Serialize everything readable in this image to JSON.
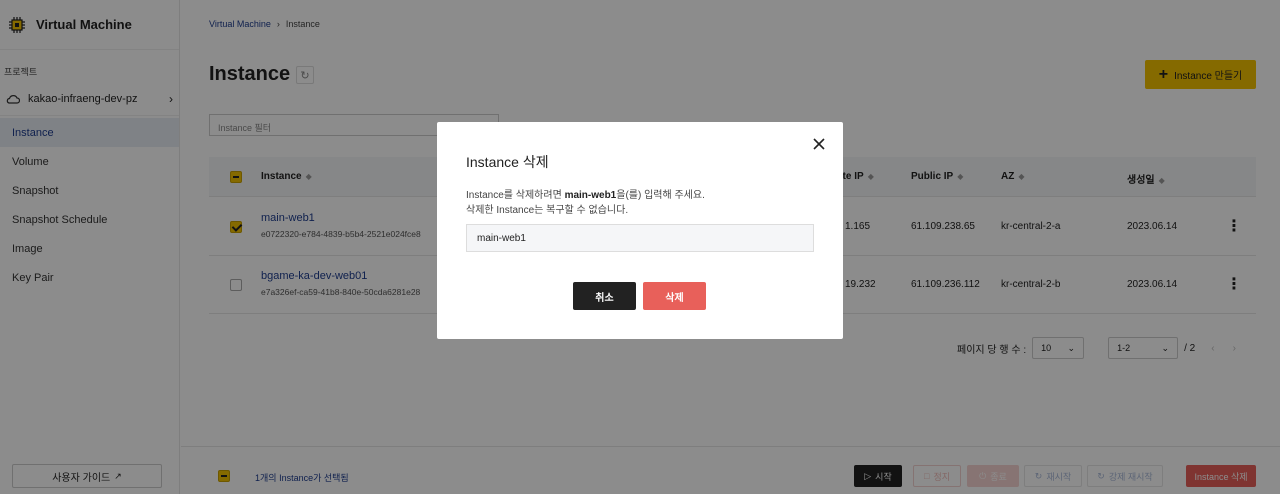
{
  "sidebar": {
    "brand_title": "Virtual Machine",
    "project_label": "프로젝트",
    "project_name": "kakao-infraeng-dev-pz",
    "nav": [
      "Instance",
      "Volume",
      "Snapshot",
      "Snapshot Schedule",
      "Image",
      "Key Pair"
    ],
    "guide_label": "사용자 가이드"
  },
  "breadcrumb": {
    "parent": "Virtual Machine",
    "sep": "›",
    "current": "Instance"
  },
  "page_title": "Instance",
  "create_label": "Instance 만들기",
  "filter_placeholder": "Instance 필터",
  "table": {
    "headers": {
      "instance": "Instance",
      "private_ip": "ate IP",
      "public_ip": "Public IP",
      "az": "AZ",
      "created": "생성일"
    },
    "rows": [
      {
        "name": "main-web1",
        "id": "e0722320-e784-4839-b5b4-2521e024fce8",
        "private_ip": "1.165",
        "public_ip": "61.109.238.65",
        "az": "kr-central-2-a",
        "created": "2023.06.14"
      },
      {
        "name": "bgame-ka-dev-web01",
        "id": "e7a326ef-ca59-41b8-840e-50cda6281e28",
        "private_ip": "19.232",
        "public_ip": "61.109.236.112",
        "az": "kr-central-2-b",
        "created": "2023.06.14"
      }
    ]
  },
  "pager": {
    "per_page_label": "페이지 당 행 수 :",
    "per_page": "10",
    "range": "1-2",
    "total": "/ 2"
  },
  "bottom": {
    "selected_info": "1개의 Instance가 선택됨",
    "start": "시작",
    "stop_faded": "정지",
    "shutdown": "종료",
    "restart": "재시작",
    "force_restart": "강제 재시작",
    "delete": "Instance 삭제"
  },
  "modal": {
    "title": "Instance 삭제",
    "desc_pre": "Instance를 삭제하려면 ",
    "desc_target": "main-web1",
    "desc_post": "을(를) 입력해 주세요.",
    "desc_line2": "삭제한 Instance는 복구할 수 없습니다.",
    "input_value": "main-web1",
    "cancel": "취소",
    "confirm": "삭제"
  },
  "colors": {
    "accent": "#f2c200",
    "link": "#1e3d8f",
    "danger": "#e8605a"
  }
}
